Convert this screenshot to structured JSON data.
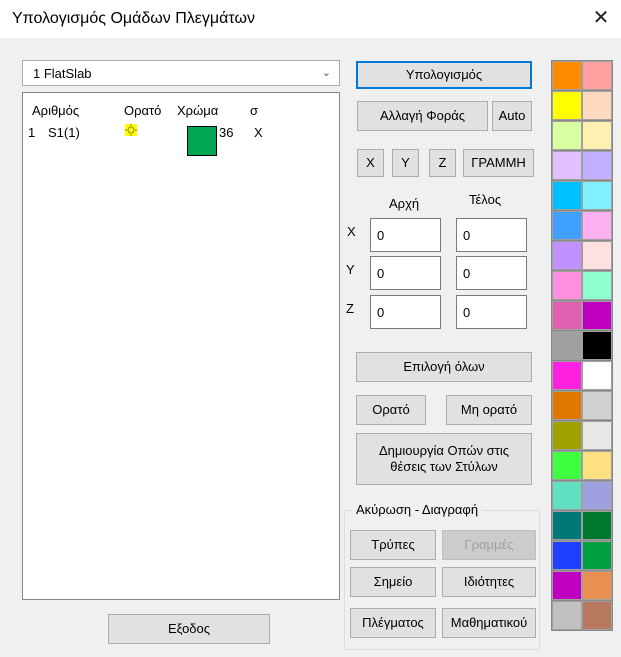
{
  "window": {
    "title": "Υπολογισμός Ομάδων Πλεγμάτων"
  },
  "combo": {
    "value": "1 FlatSlab"
  },
  "list": {
    "headers": [
      "Αριθμός",
      "Ορατό",
      "Χρώμα",
      "σ"
    ],
    "rows": [
      {
        "num": "1",
        "name": "S1(1)",
        "visible_icon": "sun-icon",
        "color": "#00a651",
        "color_code": "36",
        "sigma": "X"
      }
    ]
  },
  "buttons": {
    "calculate": "Υπολογισμός",
    "change_direction": "Αλλαγή Φοράς",
    "auto": "Auto",
    "x": "X",
    "y": "Y",
    "z": "Z",
    "line": "ΓΡΑΜΜΗ",
    "select_all": "Επιλογή όλων",
    "visible": "Ορατό",
    "not_visible": "Μη ορατό",
    "create_holes": "Δημιουργία Οπών στις θέσεις των Στύλων",
    "holes": "Τρύπες",
    "lines": "Γραμμές",
    "point": "Σημείο",
    "properties": "Ιδιότητες",
    "mesh": "Πλέγματος",
    "math": "Μαθηματικού",
    "exit": "Εξοδος"
  },
  "coords": {
    "start_label": "Αρχή",
    "end_label": "Τέλος",
    "axes": [
      "X",
      "Y",
      "Z"
    ],
    "start": [
      "0",
      "0",
      "0"
    ],
    "end": [
      "0",
      "0",
      "0"
    ]
  },
  "group_title": "Ακύρωση - Διαγραφή",
  "palette": [
    [
      "#ff8c00",
      "#ffa0a0"
    ],
    [
      "#ffff00",
      "#ffd8c0"
    ],
    [
      "#d8ffa0",
      "#ffefb0"
    ],
    [
      "#e0c0ff",
      "#c0b0ff"
    ],
    [
      "#00c0ff",
      "#80f0ff"
    ],
    [
      "#40a0ff",
      "#ffb0f0"
    ],
    [
      "#c090ff",
      "#ffe0e0"
    ],
    [
      "#ff90e0",
      "#90ffd0"
    ],
    [
      "#e060b0",
      "#c000c0"
    ],
    [
      "#a0a0a0",
      "#000000"
    ],
    [
      "#ff20e0",
      "#ffffff"
    ],
    [
      "#e07800",
      "#d0d0d0"
    ],
    [
      "#a0a000",
      "#e8e8e8"
    ],
    [
      "#40ff40",
      "#ffe080"
    ],
    [
      "#60e0c0",
      "#a0a0e0"
    ],
    [
      "#007878",
      "#007830"
    ],
    [
      "#2040ff",
      "#00a040"
    ],
    [
      "#c000c0",
      "#e89050"
    ],
    [
      "#c0c0c0",
      "#b87860"
    ]
  ]
}
